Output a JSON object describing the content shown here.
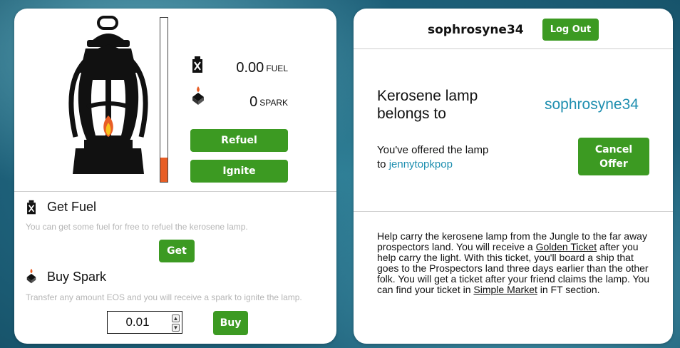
{
  "lamp": {
    "fuel_value": "0.00",
    "fuel_unit": "FUEL",
    "spark_value": "0",
    "spark_unit": "SPARK",
    "refuel_label": "Refuel",
    "ignite_label": "Ignite",
    "gauge_level": 0.15,
    "gauge_color": "#e85e25"
  },
  "get_fuel": {
    "title": "Get Fuel",
    "description": "You can get some fuel for free to refuel the kerosene lamp.",
    "button_label": "Get"
  },
  "buy_spark": {
    "title": "Buy Spark",
    "description": "Transfer any amount EOS and you will receive a spark to ignite the lamp.",
    "amount_value": "0.01",
    "button_label": "Buy"
  },
  "account": {
    "username": "sophrosyne34",
    "logout_label": "Log Out"
  },
  "ownership": {
    "heading_line1": "Kerosene lamp",
    "heading_line2": "belongs to",
    "owner": "sophrosyne34",
    "offer_text_line1": "You've offered the lamp",
    "offer_text_prefix": "to",
    "offer_recipient": "jennytopkpop",
    "cancel_label_line1": "Cancel",
    "cancel_label_line2": "Offer"
  },
  "info": {
    "part1": "Help carry the kerosene lamp from the Jungle to the far away prospectors land. You will receive a ",
    "golden_ticket": "Golden Ticket",
    "part2": " after you help carry the light. With this ticket, you'll board a ship that goes to the Prospectors land three days earlier than the other folk. You will get a ticket after your friend claims the lamp. You can find your ticket in ",
    "simple_market": "Simple Market",
    "part3": " in FT section."
  },
  "colors": {
    "accent_green": "#3c9a22",
    "link_blue": "#1f8fb0",
    "flame_orange": "#e85e25"
  }
}
